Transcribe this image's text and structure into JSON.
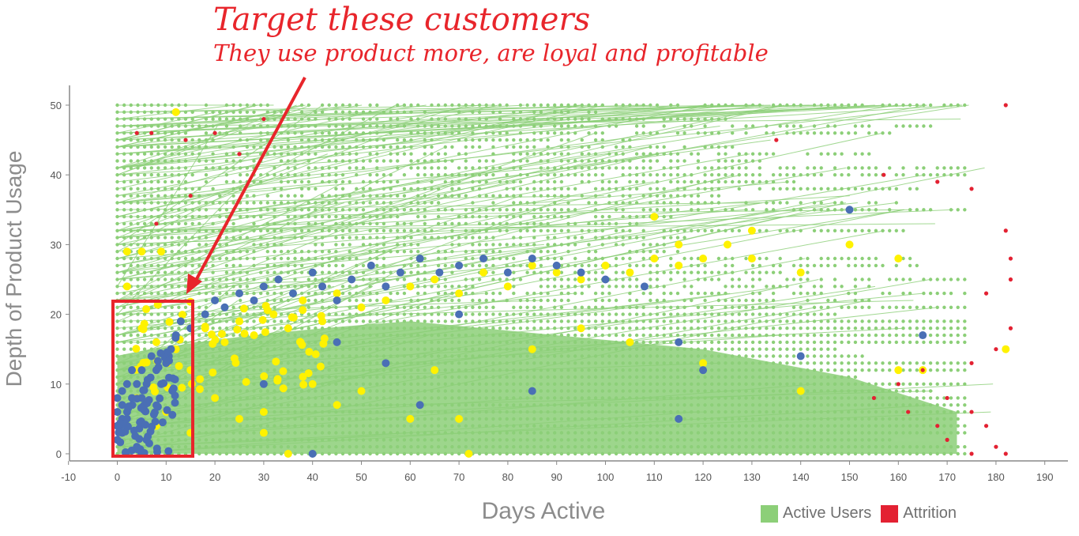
{
  "annotation": {
    "title": "Target these customers",
    "subtitle": "They use product more, are loyal and profitable"
  },
  "colors": {
    "active": "#8ccf78",
    "attrition": "#e32132",
    "yellow": "#fff200",
    "blue": "#4a6fb5",
    "annotation": "#e8252b",
    "axis": "#8c8c8c"
  },
  "legend": {
    "active_label": "Active Users",
    "attrition_label": "Attrition"
  },
  "chart_data": {
    "type": "scatter",
    "xlabel": "Days Active",
    "ylabel": "Depth of Product Usage",
    "xlim": [
      -10,
      190
    ],
    "ylim": [
      0,
      50
    ],
    "xticks": [
      -10,
      0,
      10,
      20,
      30,
      40,
      50,
      60,
      70,
      80,
      90,
      100,
      110,
      120,
      130,
      140,
      150,
      160,
      170,
      180,
      190
    ],
    "yticks": [
      0,
      10,
      20,
      30,
      40,
      50
    ],
    "grid": false,
    "legend_position": "bottom-right",
    "series": [
      {
        "name": "Active Users",
        "color": "#8ccf78",
        "description_points": [
          [
            0,
            50
          ],
          [
            182,
            50
          ],
          [
            0,
            45
          ],
          [
            135,
            45
          ],
          [
            0,
            40
          ],
          [
            158,
            40
          ],
          [
            0,
            35
          ],
          [
            175,
            35
          ],
          [
            0,
            30
          ],
          [
            182,
            30
          ],
          [
            0,
            25
          ],
          [
            180,
            25
          ],
          [
            0,
            20
          ],
          [
            178,
            20
          ],
          [
            0,
            15
          ],
          [
            180,
            15
          ],
          [
            0,
            10
          ],
          [
            175,
            10
          ],
          [
            0,
            5
          ],
          [
            172,
            5
          ],
          [
            0,
            0
          ],
          [
            172,
            0
          ]
        ]
      },
      {
        "name": "Attrition",
        "color": "#e32132",
        "points": [
          [
            182,
            50
          ],
          [
            135,
            45
          ],
          [
            157,
            40
          ],
          [
            168,
            39
          ],
          [
            175,
            38
          ],
          [
            182,
            32
          ],
          [
            183,
            28
          ],
          [
            183,
            25
          ],
          [
            178,
            23
          ],
          [
            183,
            18
          ],
          [
            180,
            15
          ],
          [
            175,
            13
          ],
          [
            165,
            12
          ],
          [
            160,
            10
          ],
          [
            155,
            8
          ],
          [
            170,
            8
          ],
          [
            162,
            6
          ],
          [
            175,
            6
          ],
          [
            168,
            4
          ],
          [
            178,
            4
          ],
          [
            170,
            2
          ],
          [
            180,
            1
          ],
          [
            175,
            0
          ],
          [
            182,
            0
          ],
          [
            4,
            46
          ],
          [
            7,
            46
          ],
          [
            14,
            45
          ],
          [
            20,
            46
          ],
          [
            25,
            43
          ],
          [
            30,
            48
          ],
          [
            8,
            33
          ],
          [
            15,
            37
          ]
        ]
      },
      {
        "name": "",
        "color": "#fff200",
        "points": [
          [
            2,
            29
          ],
          [
            5,
            29
          ],
          [
            9,
            29
          ],
          [
            2,
            24
          ],
          [
            5,
            18
          ],
          [
            8,
            16
          ],
          [
            12,
            15
          ],
          [
            15,
            12
          ],
          [
            18,
            18
          ],
          [
            22,
            16
          ],
          [
            25,
            19
          ],
          [
            28,
            17
          ],
          [
            32,
            20
          ],
          [
            35,
            18
          ],
          [
            38,
            22
          ],
          [
            42,
            19
          ],
          [
            45,
            23
          ],
          [
            50,
            21
          ],
          [
            55,
            22
          ],
          [
            60,
            24
          ],
          [
            65,
            25
          ],
          [
            70,
            23
          ],
          [
            75,
            26
          ],
          [
            80,
            24
          ],
          [
            85,
            27
          ],
          [
            90,
            26
          ],
          [
            95,
            25
          ],
          [
            100,
            27
          ],
          [
            105,
            26
          ],
          [
            110,
            28
          ],
          [
            115,
            27
          ],
          [
            120,
            28
          ],
          [
            125,
            30
          ],
          [
            130,
            28
          ],
          [
            140,
            26
          ],
          [
            150,
            30
          ],
          [
            160,
            28
          ],
          [
            110,
            34
          ],
          [
            20,
            8
          ],
          [
            30,
            6
          ],
          [
            40,
            10
          ],
          [
            45,
            7
          ],
          [
            50,
            9
          ],
          [
            60,
            5
          ],
          [
            70,
            5
          ],
          [
            65,
            12
          ],
          [
            85,
            15
          ],
          [
            105,
            16
          ],
          [
            120,
            13
          ],
          [
            140,
            9
          ],
          [
            165,
            12
          ],
          [
            182,
            15
          ],
          [
            72,
            0
          ],
          [
            35,
            0
          ],
          [
            8,
            4
          ],
          [
            4,
            8
          ],
          [
            10,
            6
          ],
          [
            15,
            3
          ],
          [
            25,
            5
          ],
          [
            30,
            3
          ],
          [
            12,
            49
          ],
          [
            130,
            32
          ],
          [
            160,
            12
          ],
          [
            115,
            30
          ],
          [
            95,
            18
          ]
        ]
      },
      {
        "name": "",
        "color": "#4a6fb5",
        "points": [
          [
            0,
            2
          ],
          [
            0,
            4
          ],
          [
            0,
            6
          ],
          [
            0,
            8
          ],
          [
            1,
            3
          ],
          [
            1,
            5
          ],
          [
            1,
            7
          ],
          [
            1,
            9
          ],
          [
            2,
            4
          ],
          [
            2,
            6
          ],
          [
            2,
            10
          ],
          [
            3,
            8
          ],
          [
            3,
            12
          ],
          [
            4,
            10
          ],
          [
            5,
            8
          ],
          [
            5,
            12
          ],
          [
            6,
            10
          ],
          [
            7,
            14
          ],
          [
            8,
            12
          ],
          [
            9,
            10
          ],
          [
            10,
            13
          ],
          [
            11,
            15
          ],
          [
            12,
            17
          ],
          [
            13,
            19
          ],
          [
            15,
            18
          ],
          [
            18,
            20
          ],
          [
            20,
            22
          ],
          [
            22,
            21
          ],
          [
            25,
            23
          ],
          [
            28,
            22
          ],
          [
            30,
            24
          ],
          [
            33,
            25
          ],
          [
            36,
            23
          ],
          [
            40,
            26
          ],
          [
            42,
            24
          ],
          [
            45,
            22
          ],
          [
            48,
            25
          ],
          [
            52,
            27
          ],
          [
            55,
            24
          ],
          [
            58,
            26
          ],
          [
            62,
            28
          ],
          [
            66,
            26
          ],
          [
            70,
            27
          ],
          [
            75,
            28
          ],
          [
            80,
            26
          ],
          [
            85,
            28
          ],
          [
            90,
            27
          ],
          [
            95,
            26
          ],
          [
            100,
            25
          ],
          [
            108,
            24
          ],
          [
            115,
            16
          ],
          [
            120,
            12
          ],
          [
            140,
            14
          ],
          [
            150,
            35
          ],
          [
            165,
            17
          ],
          [
            40,
            0
          ],
          [
            30,
            10
          ],
          [
            45,
            16
          ],
          [
            55,
            13
          ],
          [
            62,
            7
          ],
          [
            70,
            20
          ],
          [
            85,
            9
          ],
          [
            115,
            5
          ],
          [
            6,
            2
          ],
          [
            4,
            1
          ]
        ]
      }
    ]
  }
}
